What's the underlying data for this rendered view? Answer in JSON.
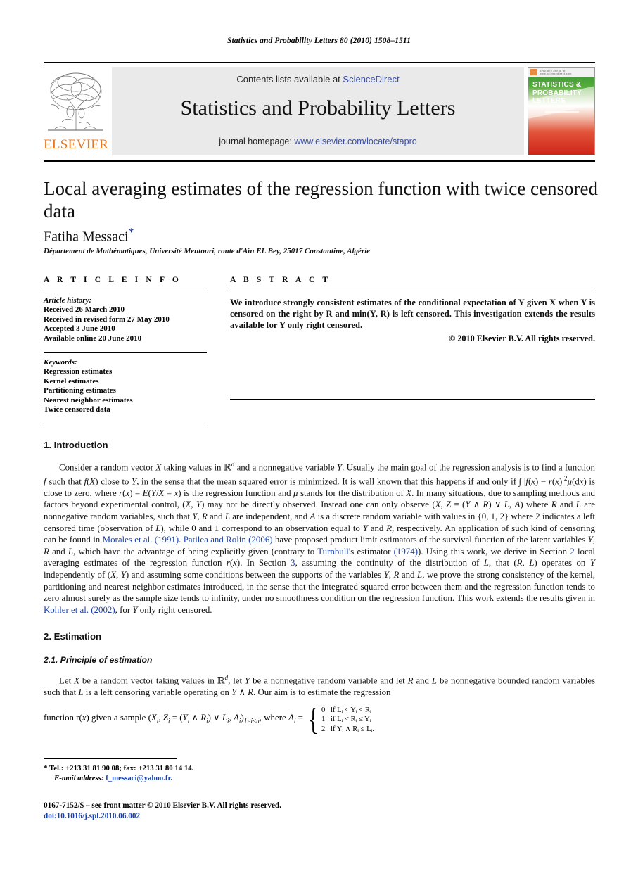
{
  "running_head": "Statistics and Probability Letters 80 (2010) 1508–1511",
  "masthead": {
    "contents_prefix": "Contents lists available at ",
    "contents_link": "ScienceDirect",
    "journal_name": "Statistics and Probability Letters",
    "homepage_prefix": "journal homepage: ",
    "homepage_link": "www.elsevier.com/locate/stapro",
    "publisher_wordmark": "ELSEVIER",
    "cover": {
      "title_line1": "STATISTICS &",
      "title_line2": "PROBABILITY",
      "title_line3": "LETTERS",
      "topbar_text": "Available online at www.sciencedirect.com"
    },
    "link_color": "#3b4fa0"
  },
  "article": {
    "title": "Local averaging estimates of the regression function with twice censored data",
    "author": "Fatiha Messaci",
    "author_footnote_marker": "*",
    "affiliation": "Département de Mathématiques, Université Mentouri, route d'Aïn EL Bey, 25017 Constantine, Algérie"
  },
  "info": {
    "heading": "A R T I C L E   I N F O",
    "history_label": "Article history:",
    "history": [
      "Received 26 March 2010",
      "Received in revised form 27 May 2010",
      "Accepted 3 June 2010",
      "Available online 20 June 2010"
    ],
    "keywords_label": "Keywords:",
    "keywords": [
      "Regression estimates",
      "Kernel estimates",
      "Partitioning estimates",
      "Nearest neighbor estimates",
      "Twice censored data"
    ]
  },
  "abstract": {
    "heading": "A B S T R A C T",
    "text": "We introduce strongly consistent estimates of the conditional expectation of Y given X when Y is censored on the right by R and min(Y, R) is left censored. This investigation extends the results available for Y only right censored.",
    "copyright": "© 2010 Elsevier B.V. All rights reserved."
  },
  "sections": {
    "intro_heading": "1.  Introduction",
    "intro_p1_a": "Consider a random vector ",
    "intro_p1_rest": " taking values in ",
    "estimation_heading": "2.  Estimation",
    "principle_heading": "2.1.  Principle of estimation"
  },
  "citations": {
    "morales": "Morales et al. (1991)",
    "patilea": "Patilea and Rolin (2006)",
    "turnbull_name": "Turnbull",
    "turnbull_year": "(1974)",
    "kohler": "Kohler et al. (2002)",
    "section2": "2",
    "section3": "3",
    "color": "#1a3faa"
  },
  "formula": {
    "cases": [
      {
        "value": "0",
        "condition": "if Lᵢ < Yᵢ < Rᵢ"
      },
      {
        "value": "1",
        "condition": "if Lᵢ < Rᵢ ≤ Yᵢ"
      },
      {
        "value": "2",
        "condition": "if Yᵢ ∧ Rᵢ ≤ Lᵢ."
      }
    ]
  },
  "footnotes": {
    "tel_line": "Tel.: +213 31 81 90 08; fax: +213 31 80 14 14.",
    "email_label": "E-mail address:",
    "email": "f_messaci@yahoo.fr",
    "email_trailing": "."
  },
  "imprint": {
    "line1": "0167-7152/$ – see front matter © 2010 Elsevier B.V. All rights reserved.",
    "doi": "doi:10.1016/j.spl.2010.06.002"
  }
}
